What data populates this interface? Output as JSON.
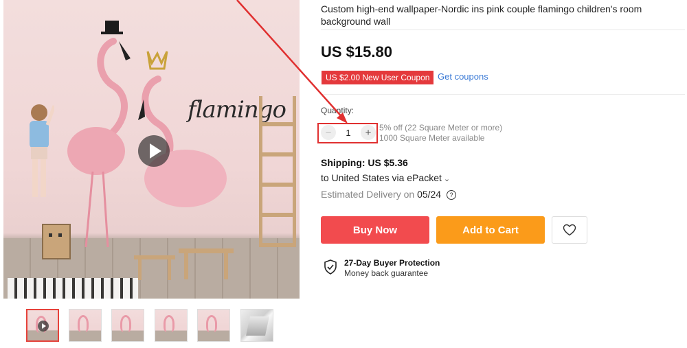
{
  "product": {
    "title": "Custom high-end wallpaper-Nordic ins pink couple flamingo children's room background wall",
    "image_caption": "flamingo",
    "price": "US $15.80",
    "coupon": {
      "badge": "US $2.00 New User Coupon",
      "link": "Get coupons"
    }
  },
  "quantity": {
    "label": "Quantity:",
    "value": "1",
    "minus": "−",
    "plus": "+",
    "discount_note": "5% off (22 Square Meter or more)",
    "available_note": "1000 Square Meter available"
  },
  "shipping": {
    "price": "Shipping: US $5.36",
    "destination": "to United States via ePacket",
    "chevron": "⌄",
    "delivery_prefix": "Estimated Delivery on",
    "delivery_date": "05/24",
    "help_glyph": "?"
  },
  "actions": {
    "buy_now": "Buy Now",
    "add_to_cart": "Add to Cart"
  },
  "protection": {
    "title": "27-Day Buyer Protection",
    "subtitle": "Money back guarantee"
  },
  "thumbnails": [
    {
      "kind": "video"
    },
    {
      "kind": "image"
    },
    {
      "kind": "image"
    },
    {
      "kind": "image"
    },
    {
      "kind": "image"
    },
    {
      "kind": "roll"
    }
  ],
  "icons": {
    "play": "play-icon",
    "heart": "heart-icon",
    "shield": "shield-check-icon"
  },
  "colors": {
    "buy_now": "#f24b4e",
    "add_to_cart": "#fb9b1a",
    "coupon": "#e4393c",
    "link": "#3c7bd6",
    "annotation": "#e03030"
  }
}
